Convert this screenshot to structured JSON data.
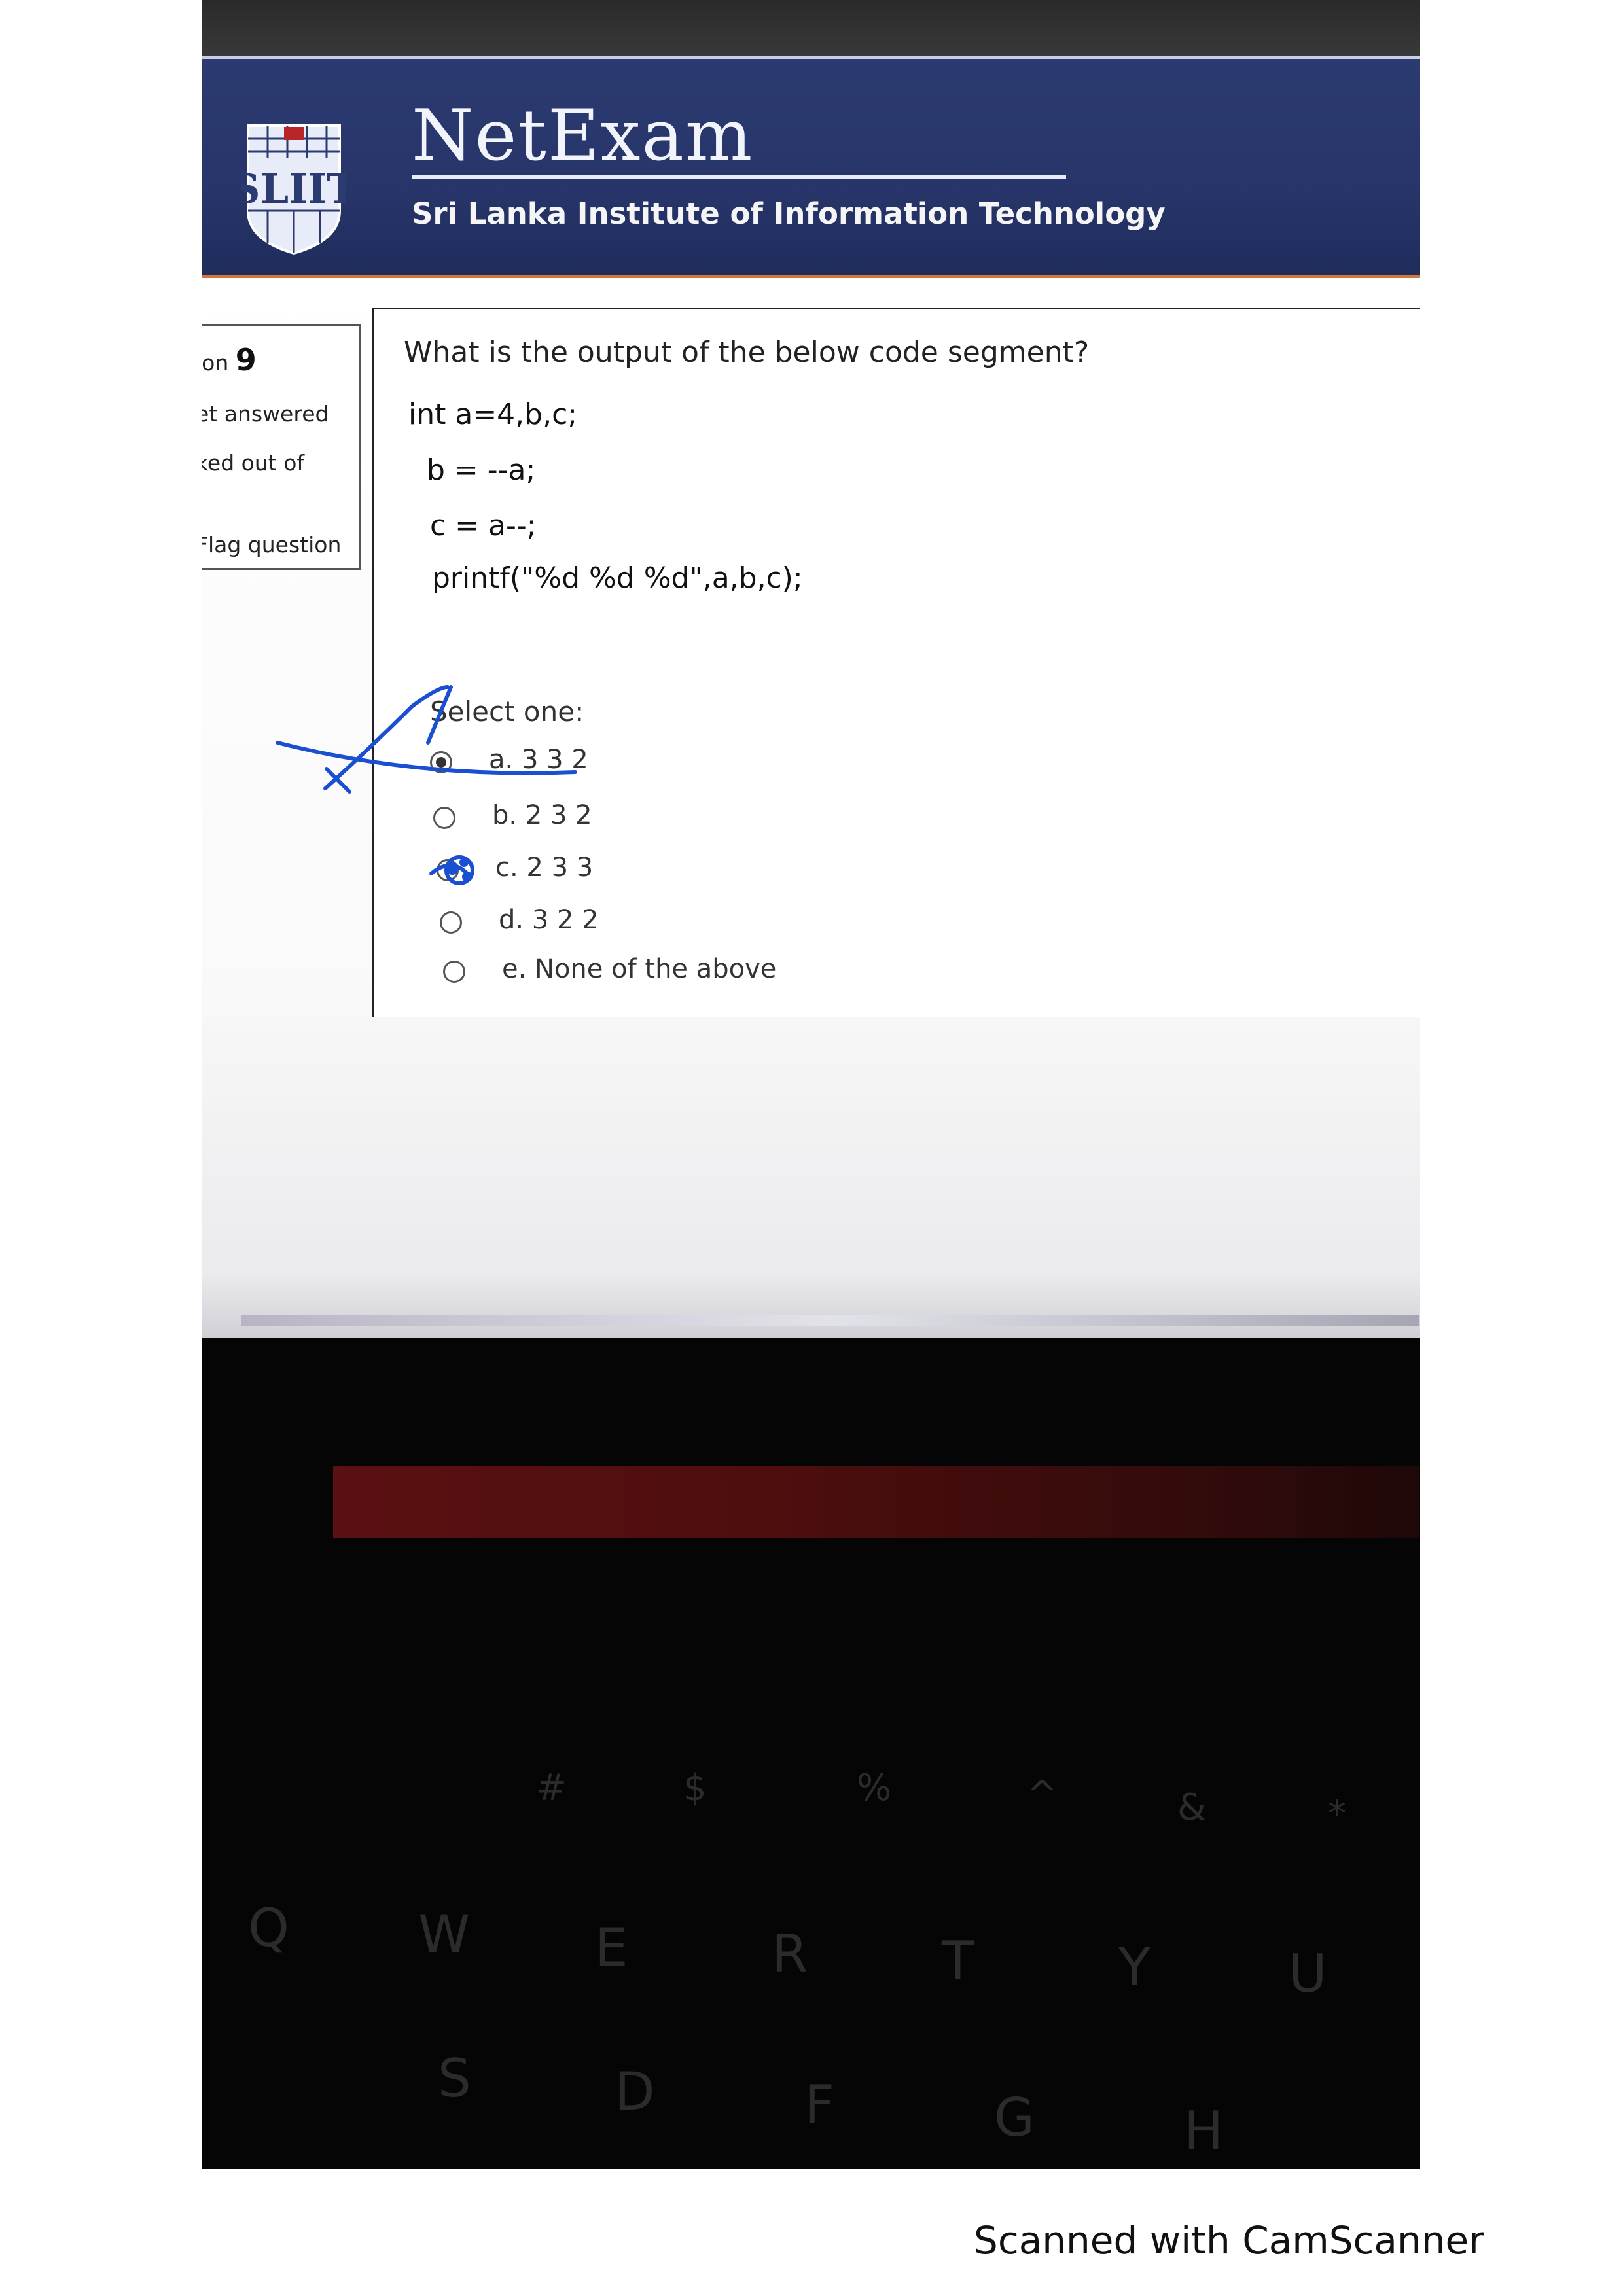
{
  "header": {
    "logo_text": "SLIIT",
    "brand": "NetExam",
    "institute": "Sri Lanka Institute of Information Technology"
  },
  "question_info": {
    "number_label": "ion",
    "number": "9",
    "status": "et answered",
    "mark": "ked out of",
    "flag": "Flag question"
  },
  "question": {
    "prompt": "What is the output of the below code segment?",
    "code": [
      "int a=4,b,c;",
      "b = --a;",
      "c = a--;",
      "printf(\"%d %d %d\",a,b,c);"
    ],
    "select_label": "Select one:",
    "options": [
      {
        "label": "a. 3 3 2",
        "selected": true
      },
      {
        "label": "b. 2 3 2",
        "selected": false
      },
      {
        "label": "c. 2 3 3",
        "selected": false
      },
      {
        "label": "d. 3 2 2",
        "selected": false
      },
      {
        "label": "e. None of the above",
        "selected": false
      }
    ]
  },
  "keyboard": {
    "row1": [
      "#",
      "$",
      "%",
      "^",
      "&",
      "*"
    ],
    "row2": [
      "Q",
      "W",
      "E",
      "R",
      "T",
      "Y",
      "U"
    ],
    "row3": [
      "S",
      "D",
      "F",
      "G",
      "H"
    ]
  },
  "footer": {
    "scan_text": "Scanned with CamScanner"
  },
  "colors": {
    "banner": "#2b3a70",
    "banner_border": "#d2773a",
    "annotation_ink": "#1a4fd1"
  }
}
